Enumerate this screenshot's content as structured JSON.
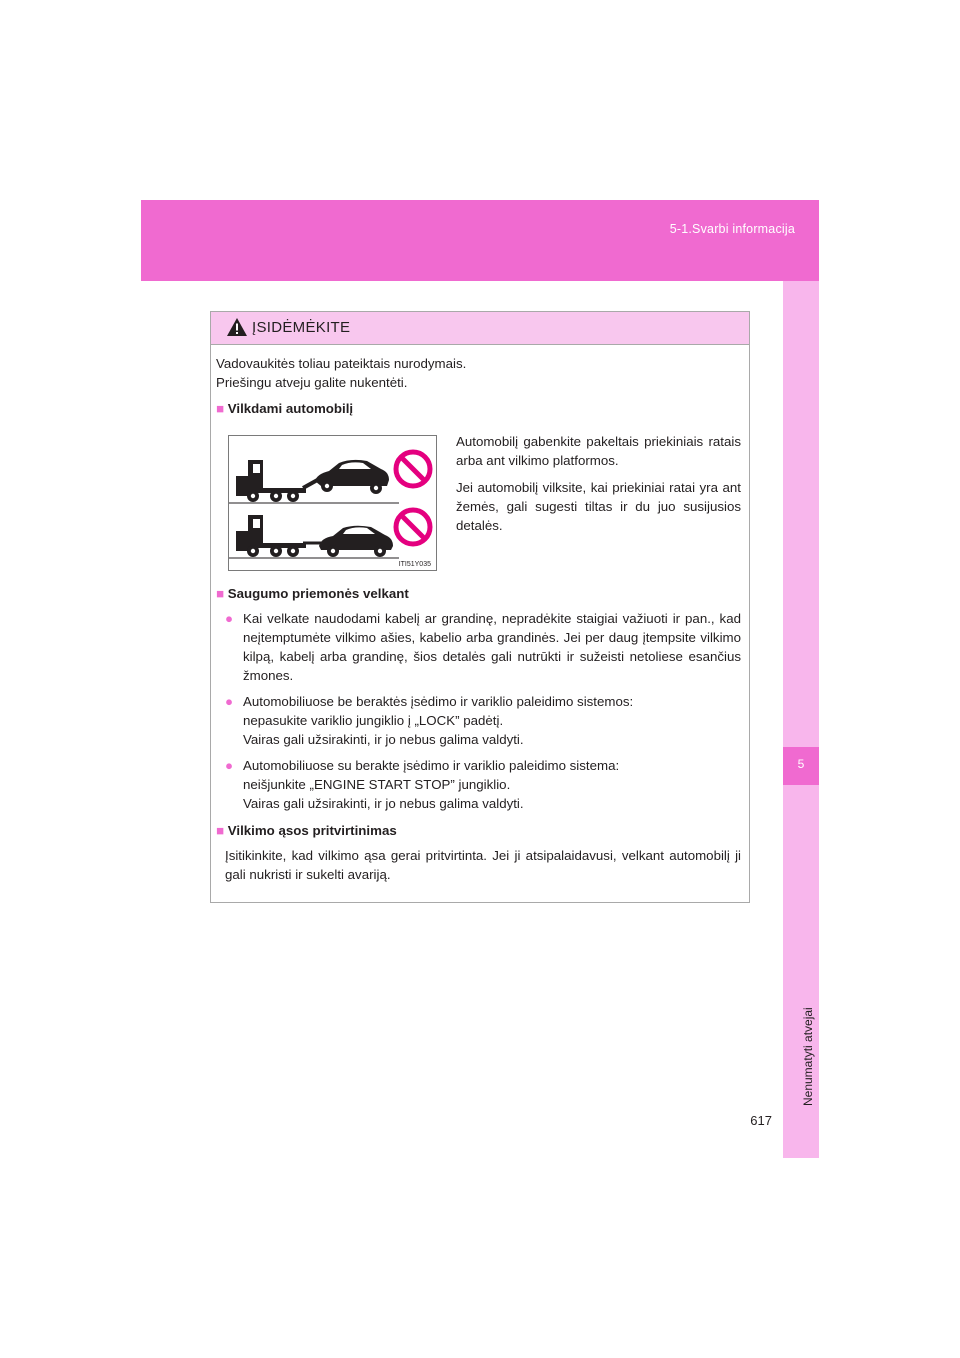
{
  "header": {
    "section": "5-1.Svarbi informacija"
  },
  "side_tab": {
    "number": "5",
    "label": "Nenumatyti atvejai"
  },
  "page_number": "617",
  "caution": {
    "title": "ĮSIDĖMĖKITE",
    "intro_line1": "Vadovaukitės toliau pateiktais nurodymais.",
    "intro_line2": "Priešingu atveju galite nukentėti.",
    "section1": {
      "heading": "Vilkdami automobilį",
      "para1": "Automobilį gabenkite pakeltais priekiniais ratais arba ant vilkimo platformos.",
      "para2": "Jei automobilį vilksite, kai priekiniai ratai yra ant žemės, gali sugesti tiltas ir du juo susijusios detalės.",
      "figure_code": "ITI51Y035"
    },
    "section2": {
      "heading": "Saugumo priemonės velkant",
      "item1": "Kai velkate naudodami kabelį ar grandinę, nepradėkite staigiai važiuoti ir pan., kad neįtemptumėte vilkimo ašies, kabelio arba grandinės. Jei per daug įtempsite vilkimo kilpą, kabelį arba grandinę, šios detalės gali nutrūkti ir sužeisti netoliese esančius žmones.",
      "item2_line1": "Automobiliuose be beraktės įsėdimo ir variklio paleidimo sistemos:",
      "item2_line2": "nepasukite variklio jungiklio į „LOCK” padėtį.",
      "item2_line3": "Vairas gali užsirakinti, ir jo nebus galima valdyti.",
      "item3_line1": "Automobiliuose su berakte įsėdimo ir variklio paleidimo sistema:",
      "item3_line2": "neišjunkite „ENGINE START STOP” jungiklio.",
      "item3_line3": "Vairas gali užsirakinti, ir jo nebus galima valdyti."
    },
    "section3": {
      "heading": "Vilkimo ąsos pritvirtinimas",
      "para": "Įsitikinkite, kad vilkimo ąsa gerai pritvirtinta. Jei ji atsipalaidavusi, velkant automobilį ji gali nukristi ir sukelti avariją."
    },
    "bullet_square": "■",
    "bullet_circle": "●"
  },
  "colors": {
    "accent": "#f06ad0",
    "tab": "#f8b6ec",
    "caution_header": "#f8c7ee",
    "prohibit_red": "#e4007f"
  }
}
